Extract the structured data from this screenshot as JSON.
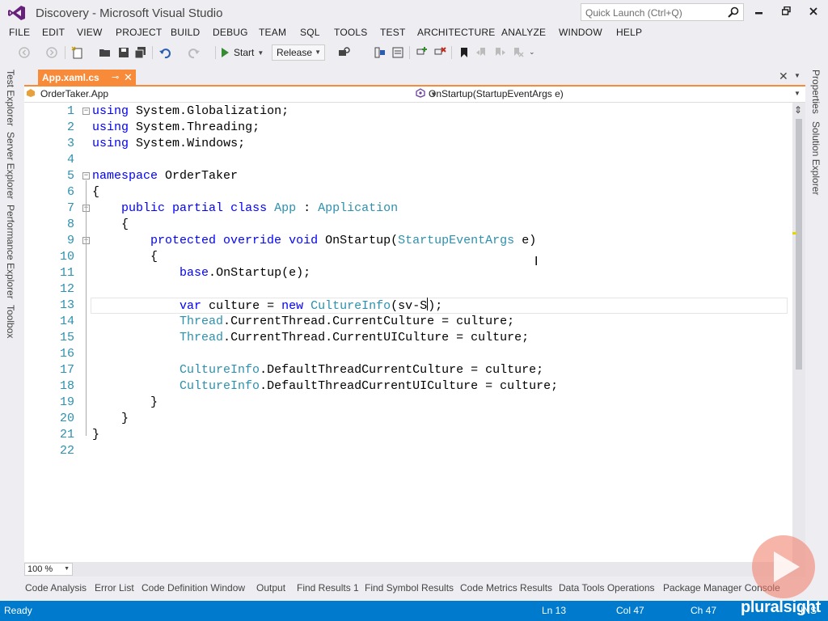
{
  "window": {
    "title": "Discovery - Microsoft Visual Studio",
    "quick_launch_placeholder": "Quick Launch (Ctrl+Q)"
  },
  "menu": [
    "FILE",
    "EDIT",
    "VIEW",
    "PROJECT",
    "BUILD",
    "DEBUG",
    "TEAM",
    "SQL",
    "TOOLS",
    "TEST",
    "ARCHITECTURE",
    "ANALYZE",
    "WINDOW",
    "HELP"
  ],
  "toolbar": {
    "start_label": "Start",
    "configuration": "Release"
  },
  "left_tool_tabs": [
    "Test Explorer",
    "Server Explorer",
    "Performance Explorer",
    "Toolbox"
  ],
  "right_tool_tabs": [
    "Properties",
    "Solution Explorer"
  ],
  "document_tab": {
    "name": "App.xaml.cs",
    "pin_glyph": "⊸",
    "close_glyph": "✕"
  },
  "navigation": {
    "type_scope": "OrderTaker.App",
    "member_scope": "OnStartup(StartupEventArgs e)"
  },
  "editor": {
    "current_line": 13,
    "zoom": "100 %",
    "lines": [
      {
        "n": "1",
        "t": "using System.Globalization;"
      },
      {
        "n": "2",
        "t": "using System.Threading;"
      },
      {
        "n": "3",
        "t": "using System.Windows;"
      },
      {
        "n": "4",
        "t": ""
      },
      {
        "n": "5",
        "t": "namespace OrderTaker"
      },
      {
        "n": "6",
        "t": "{"
      },
      {
        "n": "7",
        "t": "    public partial class App : Application"
      },
      {
        "n": "8",
        "t": "    {"
      },
      {
        "n": "9",
        "t": "        protected override void OnStartup(StartupEventArgs e)"
      },
      {
        "n": "10",
        "t": "        {"
      },
      {
        "n": "11",
        "t": "            base.OnStartup(e);"
      },
      {
        "n": "12",
        "t": ""
      },
      {
        "n": "13",
        "t": "            var culture = new CultureInfo(\"sv-S\");"
      },
      {
        "n": "14",
        "t": "            Thread.CurrentThread.CurrentCulture = culture;"
      },
      {
        "n": "15",
        "t": "            Thread.CurrentThread.CurrentUICulture = culture;"
      },
      {
        "n": "16",
        "t": ""
      },
      {
        "n": "17",
        "t": "            CultureInfo.DefaultThreadCurrentCulture = culture;"
      },
      {
        "n": "18",
        "t": "            CultureInfo.DefaultThreadCurrentUICulture = culture;"
      },
      {
        "n": "19",
        "t": "        }"
      },
      {
        "n": "20",
        "t": "    }"
      },
      {
        "n": "21",
        "t": "}"
      },
      {
        "n": "22",
        "t": ""
      }
    ]
  },
  "bottom_tabs": [
    "Code Analysis",
    "Error List",
    "Code Definition Window",
    "Output",
    "Find Results 1",
    "Find Symbol Results",
    "Code Metrics Results",
    "Data Tools Operations",
    "Package Manager Console"
  ],
  "status": {
    "state": "Ready",
    "ln": "Ln 13",
    "col": "Col 47",
    "ch": "Ch 47",
    "mode": "INS"
  },
  "watermark": "pluralsight",
  "colors": {
    "status_bar": "#007acc",
    "active_tab": "#f78b39",
    "keyword": "#0000ff",
    "type": "#2b91af",
    "string": "#a31515",
    "line_number": "#2b91af"
  }
}
